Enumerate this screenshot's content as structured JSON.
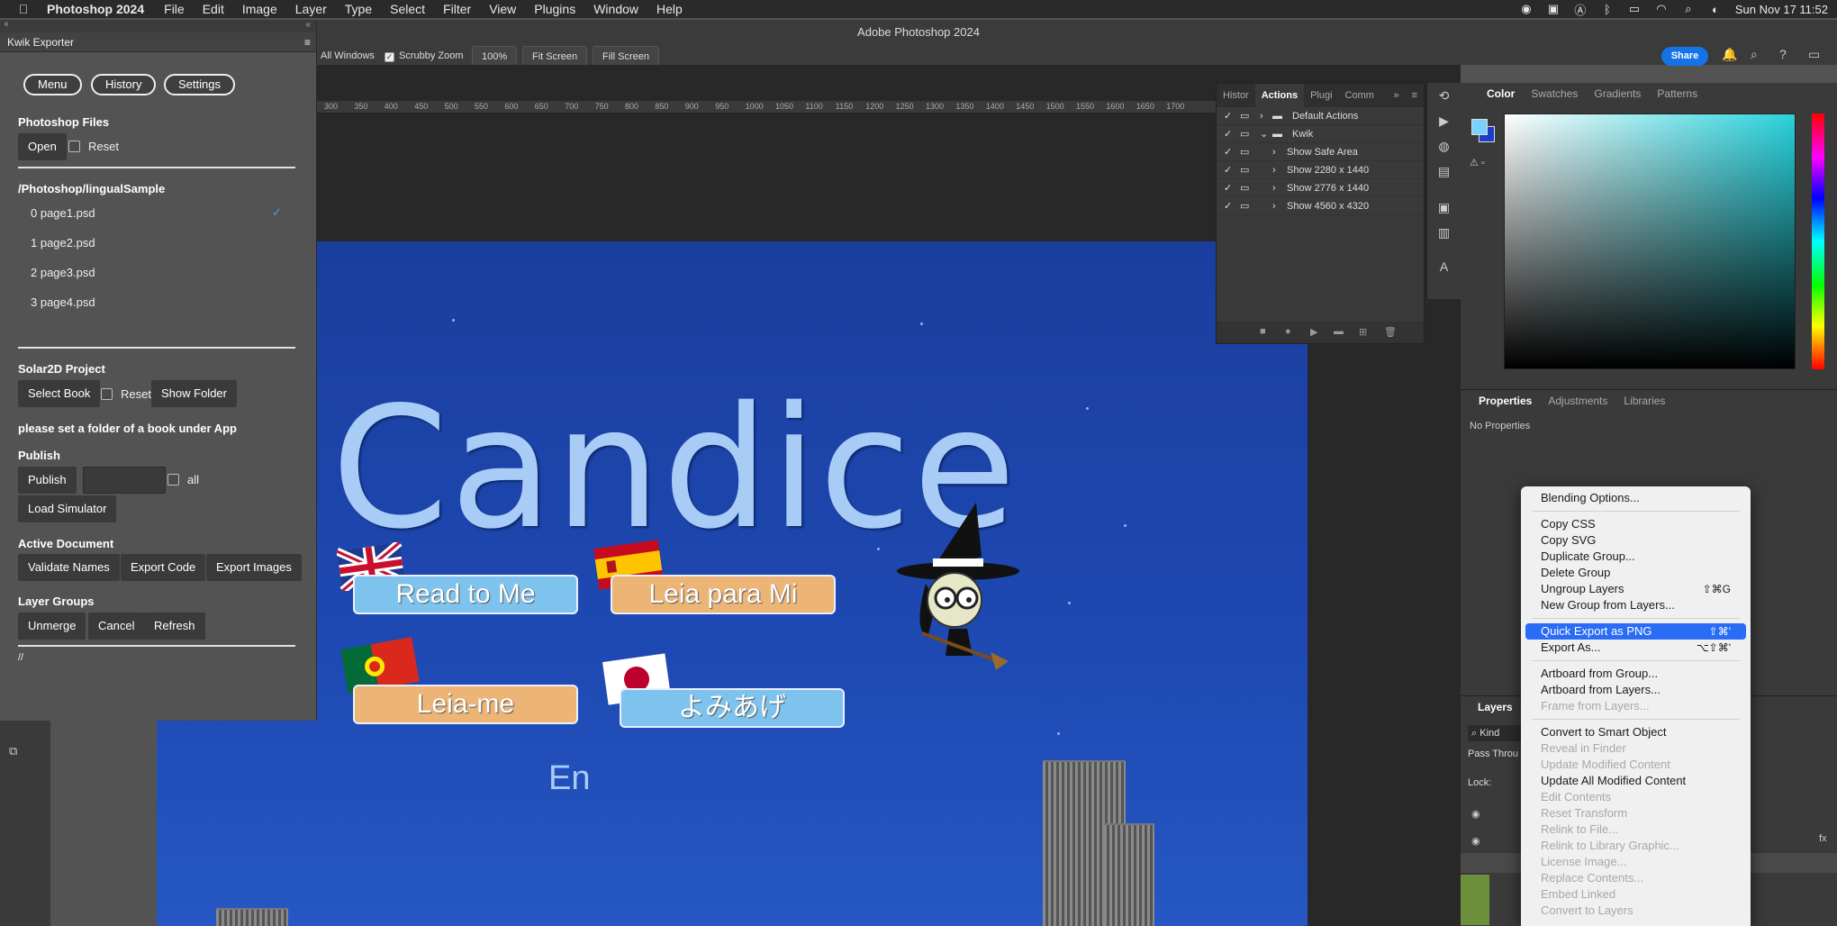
{
  "menubar": {
    "app_name": "Photoshop 2024",
    "items": [
      "File",
      "Edit",
      "Image",
      "Layer",
      "Type",
      "Select",
      "Filter",
      "View",
      "Plugins",
      "Window",
      "Help"
    ],
    "datetime": "Sun Nov 17  11:52"
  },
  "window_title": "Adobe Photoshop 2024",
  "options": {
    "all_windows": "All Windows",
    "scrubby_zoom": "Scrubby Zoom",
    "zoom_value": "100%",
    "fit_screen": "Fit Screen",
    "fill_screen": "Fill Screen",
    "share": "Share"
  },
  "ruler_ticks": [
    "300",
    "350",
    "400",
    "450",
    "500",
    "550",
    "600",
    "650",
    "700",
    "750",
    "800",
    "850",
    "900",
    "950",
    "1000",
    "1050",
    "1100",
    "1150",
    "1200",
    "1250",
    "1300",
    "1350",
    "1400",
    "1450",
    "1500",
    "1550",
    "1600",
    "1650",
    "1700"
  ],
  "kwik": {
    "title": "Kwik Exporter",
    "menu": "Menu",
    "history": "History",
    "settings": "Settings",
    "photoshop_files": "Photoshop Files",
    "open": "Open",
    "reset": "Reset",
    "path": "/Photoshop/lingualSample",
    "files": [
      "0 page1.psd",
      "1 page2.psd",
      "2 page3.psd",
      "3 page4.psd"
    ],
    "check_mark": "✓",
    "solar2d": "Solar2D Project",
    "select_book": "Select Book",
    "reset2": "Reset",
    "show_folder": "Show Folder",
    "hint": "please set a folder of a book under App",
    "publish_heading": "Publish",
    "publish": "Publish",
    "all": "all",
    "load_simulator": "Load Simulator",
    "active_document": "Active Document",
    "validate_names": "Validate Names",
    "export_code": "Export Code",
    "export_images": "Export Images",
    "layer_groups": "Layer Groups",
    "unmerge": "Unmerge",
    "cancel": "Cancel",
    "refresh": "Refresh",
    "footer": "//"
  },
  "canvas": {
    "title": "Candice",
    "buttons": [
      "Read to Me",
      "Leia para Mi",
      "Leia-me",
      "よみあげ"
    ],
    "lang_code": "En"
  },
  "actions_panel": {
    "tabs": [
      "Histor",
      "Actions",
      "Plugi",
      "Comm"
    ],
    "rows": [
      "Default Actions",
      "Kwik",
      "Show Safe Area",
      "Show 2280 x 1440",
      "Show 2776 x 1440",
      "Show 4560 x 4320"
    ]
  },
  "color_panel": {
    "tabs": [
      "Color",
      "Swatches",
      "Gradients",
      "Patterns"
    ]
  },
  "properties_panel": {
    "tabs": [
      "Properties",
      "Adjustments",
      "Libraries"
    ],
    "empty": "No Properties"
  },
  "layers_panel": {
    "tab": "Layers",
    "kind": "Kind",
    "blend": "Pass Throu",
    "lock": "Lock:"
  },
  "context_menu": {
    "groups": [
      [
        {
          "label": "Blending Options...",
          "enabled": true
        }
      ],
      [
        {
          "label": "Copy CSS",
          "enabled": true
        },
        {
          "label": "Copy SVG",
          "enabled": true
        },
        {
          "label": "Duplicate Group...",
          "enabled": true
        },
        {
          "label": "Delete Group",
          "enabled": true
        },
        {
          "label": "Ungroup Layers",
          "enabled": true,
          "shortcut": "⇧⌘G"
        },
        {
          "label": "New Group from Layers...",
          "enabled": true
        }
      ],
      [
        {
          "label": "Quick Export as PNG",
          "enabled": true,
          "selected": true,
          "shortcut": "⇧⌘'"
        },
        {
          "label": "Export As...",
          "enabled": true,
          "shortcut": "⌥⇧⌘'"
        }
      ],
      [
        {
          "label": "Artboard from Group...",
          "enabled": true
        },
        {
          "label": "Artboard from Layers...",
          "enabled": true
        },
        {
          "label": "Frame from Layers...",
          "enabled": false
        }
      ],
      [
        {
          "label": "Convert to Smart Object",
          "enabled": true
        },
        {
          "label": "Reveal in Finder",
          "enabled": false
        },
        {
          "label": "Update Modified Content",
          "enabled": false
        },
        {
          "label": "Update All Modified Content",
          "enabled": true
        },
        {
          "label": "Edit Contents",
          "enabled": false
        },
        {
          "label": "Reset Transform",
          "enabled": false
        },
        {
          "label": "Relink to File...",
          "enabled": false
        },
        {
          "label": "Relink to Library Graphic...",
          "enabled": false
        },
        {
          "label": "License Image...",
          "enabled": false
        },
        {
          "label": "Replace Contents...",
          "enabled": false
        },
        {
          "label": "Embed Linked",
          "enabled": false
        },
        {
          "label": "Convert to Layers",
          "enabled": false
        }
      ]
    ]
  }
}
